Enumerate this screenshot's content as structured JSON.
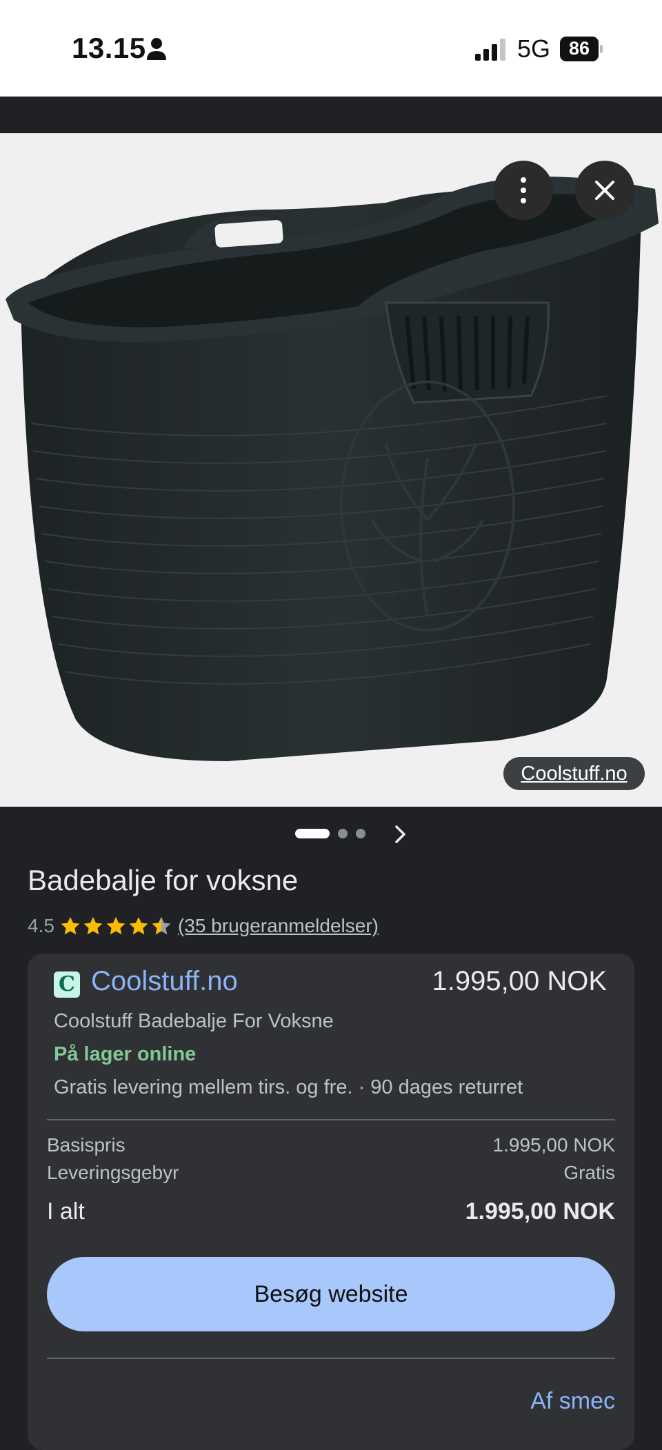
{
  "status_bar": {
    "time": "13.15",
    "network": "5G",
    "battery": "86",
    "signal_bars": 3
  },
  "browser": {
    "url": "google.com"
  },
  "image": {
    "source_label": "Coolstuff.no",
    "page_count": 3,
    "current_page": 1
  },
  "product": {
    "title": "Badebalje for voksne",
    "rating": "4.5",
    "stars_value": 4.5,
    "reviews_label": "(35 brugeranmeldelser)"
  },
  "offer": {
    "merchant": "Coolstuff.no",
    "favicon_letter": "C",
    "price": "1.995,00 NOK",
    "product_name": "Coolstuff Badebalje For Voksne",
    "stock_status": "På lager online",
    "shipping_info": "Gratis levering mellem tirs. og fre. · 90 dages returret",
    "base_price_label": "Basispris",
    "base_price_value": "1.995,00 NOK",
    "delivery_fee_label": "Leveringsgebyr",
    "delivery_fee_value": "Gratis",
    "total_label": "I alt",
    "total_value": "1.995,00 NOK",
    "visit_button": "Besøg website",
    "seller_link": "Af smec"
  },
  "colors": {
    "accent": "#8ab4f8",
    "button": "#a8c7fa",
    "in_stock": "#81c995",
    "star": "#fbbc04",
    "card": "#303134",
    "background": "#202124"
  }
}
